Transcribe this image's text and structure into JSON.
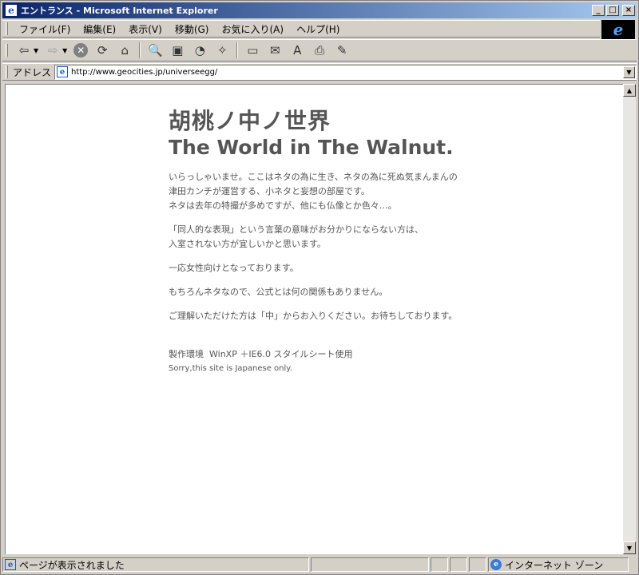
{
  "window": {
    "title": "エントランス - Microsoft Internet Explorer",
    "controls": {
      "minimize": "_",
      "maximize": "□",
      "close": "×"
    }
  },
  "menu": {
    "items": [
      {
        "label": "ファイル(F)"
      },
      {
        "label": "編集(E)"
      },
      {
        "label": "表示(V)"
      },
      {
        "label": "移動(G)"
      },
      {
        "label": "お気に入り(A)"
      },
      {
        "label": "ヘルプ(H)"
      }
    ]
  },
  "toolbar": {
    "icons": {
      "back": "back-arrow-icon",
      "forward": "forward-arrow-icon",
      "stop": "stop-icon",
      "refresh": "refresh-icon",
      "home": "home-icon",
      "search": "search-icon",
      "favorites": "favorites-icon",
      "history": "history-icon",
      "channels": "channels-icon",
      "fullscreen": "fullscreen-icon",
      "mail": "mail-icon",
      "font": "font-icon",
      "print": "print-icon",
      "edit": "edit-icon"
    },
    "glyphs": {
      "back": "⇦",
      "forward": "⇨",
      "stop": "✕",
      "refresh": "⟳",
      "home": "⌂",
      "search": "🔍",
      "favorites": "▣",
      "history": "◔",
      "channels": "✧",
      "fullscreen": "▭",
      "mail": "✉",
      "font": "A",
      "print": "⎙",
      "edit": "✎"
    }
  },
  "address": {
    "label": "アドレス",
    "url": "http://www.geocities.jp/universeegg/"
  },
  "page": {
    "title_jp": "胡桃ノ中ノ世界",
    "title_en": "The World in The Walnut.",
    "paragraphs": [
      [
        "いらっしゃいませ。ここはネタの為に生き、ネタの為に死ぬ気まんまんの",
        "津田カンチが運営する、小ネタと妄想の部屋です。",
        "ネタは去年の特撮が多めですが、他にも仏像とか色々…。"
      ],
      [
        "「同人的な表現」という言葉の意味がお分かりにならない方は、",
        "入室されない方が宜しいかと思います。"
      ],
      [
        "一応女性向けとなっております。"
      ],
      [
        "もちろんネタなので、公式とは何の関係もありません。"
      ],
      [
        "ご理解いただけた方は「中」からお入りください。お待ちしております。"
      ]
    ],
    "footer": {
      "environment_label": "製作環境",
      "environment_value": "WinXP ＋IE6.0 スタイルシート使用",
      "english_note": "Sorry,this site is Japanese only."
    }
  },
  "status": {
    "message": "ページが表示されました",
    "zone": "インターネット ゾーン"
  },
  "colors": {
    "title_gradient_start": "#0a246a",
    "title_gradient_end": "#a6caf0",
    "chrome": "#d4d0c8",
    "content_text": "#555555"
  }
}
